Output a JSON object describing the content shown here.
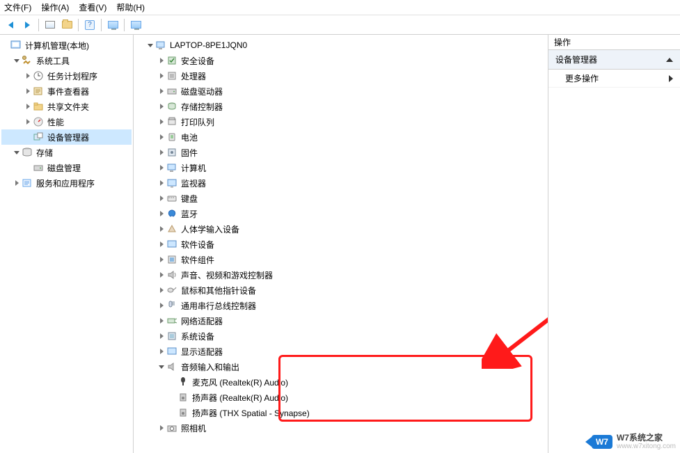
{
  "menu": {
    "file": "文件(F)",
    "action": "操作(A)",
    "view": "查看(V)",
    "help": "帮助(H)"
  },
  "left_tree": {
    "root": "计算机管理(本地)",
    "system_tools": "系统工具",
    "task_scheduler": "任务计划程序",
    "event_viewer": "事件查看器",
    "shared_folders": "共享文件夹",
    "performance": "性能",
    "device_manager": "设备管理器",
    "storage": "存储",
    "disk_mgmt": "磁盘管理",
    "services_apps": "服务和应用程序"
  },
  "mid_tree": {
    "root": "LAPTOP-8PE1JQN0",
    "items": [
      "安全设备",
      "处理器",
      "磁盘驱动器",
      "存储控制器",
      "打印队列",
      "电池",
      "固件",
      "计算机",
      "监视器",
      "键盘",
      "蓝牙",
      "人体学输入设备",
      "软件设备",
      "软件组件",
      "声音、视频和游戏控制器",
      "鼠标和其他指针设备",
      "通用串行总线控制器",
      "网络适配器",
      "系统设备",
      "显示适配器"
    ],
    "audio_cat": "音频输入和输出",
    "audio_children": [
      "麦克风 (Realtek(R) Audio)",
      "扬声器 (Realtek(R) Audio)",
      "扬声器 (THX Spatial - Synapse)"
    ],
    "camera": "照相机"
  },
  "right": {
    "title": "操作",
    "panel": "设备管理器",
    "more": "更多操作"
  },
  "watermark": {
    "badge": "W7",
    "line1": "W7系统之家",
    "line2": "www.w7xitong.com"
  }
}
